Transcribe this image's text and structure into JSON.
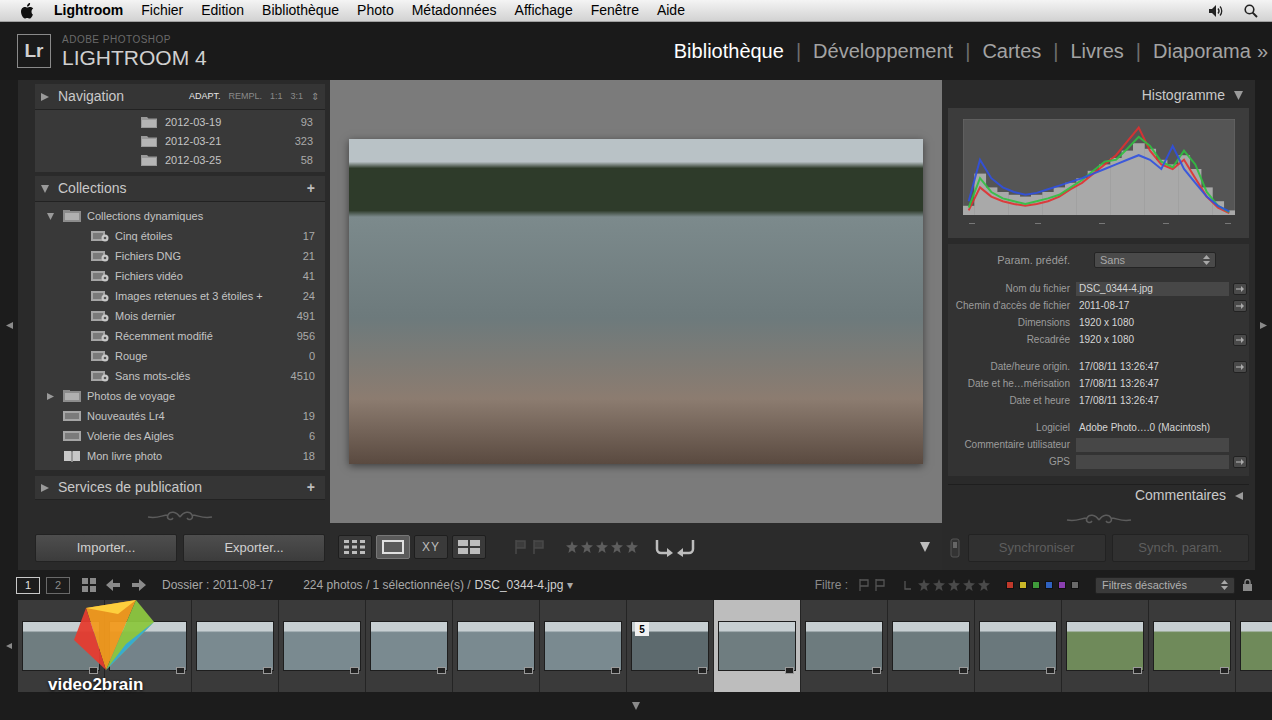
{
  "menubar": {
    "items": [
      {
        "label": "Lightroom",
        "kind": "app"
      },
      {
        "label": "Fichier",
        "kind": "menu"
      },
      {
        "label": "Edition",
        "kind": "menu"
      },
      {
        "label": "Bibliothèque",
        "kind": "menu"
      },
      {
        "label": "Photo",
        "kind": "menu"
      },
      {
        "label": "Métadonnées",
        "kind": "menu"
      },
      {
        "label": "Affichage",
        "kind": "menu"
      },
      {
        "label": "Fenêtre",
        "kind": "menu"
      },
      {
        "label": "Aide",
        "kind": "menu"
      }
    ]
  },
  "app": {
    "logo": "Lr",
    "maker": "ADOBE PHOTOSHOP",
    "name": "LIGHTROOM 4"
  },
  "modules": {
    "items": [
      {
        "label": "Bibliothèque",
        "selected": true
      },
      {
        "label": "Développement",
        "selected": false
      },
      {
        "label": "Cartes",
        "selected": false
      },
      {
        "label": "Livres",
        "selected": false
      },
      {
        "label": "Diaporama",
        "selected": false
      }
    ],
    "separator": "|",
    "more": "»"
  },
  "navigator": {
    "title": "Navigation",
    "expanded": false,
    "zoom": [
      {
        "label": "ADAPT.",
        "selected": true
      },
      {
        "label": "REMPL.",
        "selected": false
      },
      {
        "label": "1:1",
        "selected": false
      },
      {
        "label": "3:1",
        "selected": false
      }
    ],
    "zoom_more": "⇕"
  },
  "folders": [
    {
      "name": "2012-03-19",
      "count": "93"
    },
    {
      "name": "2012-03-21",
      "count": "323"
    },
    {
      "name": "2012-03-25",
      "count": "58"
    }
  ],
  "collections": {
    "title": "Collections",
    "expanded": true,
    "add": "+",
    "items": [
      {
        "name": "Collections dynamiques",
        "count": "",
        "kind": "set",
        "expanded": true,
        "children": [
          {
            "name": "Cinq étoiles",
            "count": "17",
            "kind": "smart"
          },
          {
            "name": "Fichiers DNG",
            "count": "21",
            "kind": "smart"
          },
          {
            "name": "Fichiers vidéo",
            "count": "41",
            "kind": "smart"
          },
          {
            "name": "Images retenues et 3 étoiles +",
            "count": "24",
            "kind": "smart"
          },
          {
            "name": "Mois dernier",
            "count": "491",
            "kind": "smart"
          },
          {
            "name": "Récemment modifié",
            "count": "956",
            "kind": "smart"
          },
          {
            "name": "Rouge",
            "count": "0",
            "kind": "smart"
          },
          {
            "name": "Sans mots-clés",
            "count": "4510",
            "kind": "smart"
          }
        ]
      },
      {
        "name": "Photos de voyage",
        "count": "",
        "kind": "set",
        "expanded": false,
        "children": []
      },
      {
        "name": "Nouveautés Lr4",
        "count": "19",
        "kind": "collection"
      },
      {
        "name": "Volerie des Aigles",
        "count": "6",
        "kind": "collection"
      },
      {
        "name": "Mon livre photo",
        "count": "18",
        "kind": "book"
      }
    ]
  },
  "publish": {
    "title": "Services de publication",
    "expanded": false,
    "add": "+"
  },
  "left_buttons": {
    "import": "Importer...",
    "export": "Exporter..."
  },
  "toolbar": {
    "views": [
      {
        "kind": "grid",
        "selected": false,
        "label": ""
      },
      {
        "kind": "loupe",
        "selected": true,
        "label": ""
      },
      {
        "kind": "compare",
        "selected": false,
        "label": "XY"
      },
      {
        "kind": "survey",
        "selected": false,
        "label": ""
      }
    ],
    "rating": {
      "stars": 0
    }
  },
  "histogram": {
    "title": "Histogramme",
    "expanded": true,
    "series": [
      {
        "kind": "bars",
        "color": "#a9a9a9",
        "values": [
          10,
          45,
          30,
          25,
          22,
          20,
          22,
          25,
          30,
          35,
          40,
          48,
          55,
          62,
          70,
          78,
          72,
          60,
          55,
          65,
          50,
          30,
          15,
          5
        ]
      },
      {
        "kind": "line",
        "color": "#e03030",
        "values": [
          5,
          30,
          20,
          15,
          12,
          10,
          12,
          15,
          20,
          28,
          35,
          45,
          55,
          65,
          80,
          95,
          70,
          55,
          50,
          60,
          40,
          20,
          8,
          2
        ]
      },
      {
        "kind": "line",
        "color": "#30c040",
        "values": [
          8,
          40,
          25,
          18,
          15,
          12,
          15,
          18,
          22,
          30,
          38,
          48,
          58,
          60,
          72,
          85,
          75,
          58,
          52,
          70,
          55,
          25,
          10,
          3
        ]
      },
      {
        "kind": "line",
        "color": "#3050e0",
        "values": [
          15,
          60,
          40,
          30,
          25,
          22,
          24,
          28,
          32,
          36,
          40,
          45,
          50,
          55,
          60,
          65,
          60,
          50,
          75,
          50,
          35,
          20,
          10,
          4
        ]
      }
    ]
  },
  "preset": {
    "label": "Param. prédéf.",
    "value": "Sans"
  },
  "metadata": [
    [
      {
        "label": "Nom du fichier",
        "value": "DSC_0344-4.jpg",
        "editable": true,
        "button": true
      },
      {
        "label": "Chemin d'accès de fichier",
        "value": "2011-08-17",
        "editable": false,
        "button": true
      },
      {
        "label": "Dimensions",
        "value": "1920 x 1080",
        "editable": false,
        "button": false
      },
      {
        "label": "Recadrée",
        "value": "1920 x 1080",
        "editable": false,
        "button": true
      }
    ],
    [
      {
        "label": "Date/heure origin.",
        "value": "17/08/11 13:26:47",
        "editable": false,
        "button": true
      },
      {
        "label": "Date et he…mérisation",
        "value": "17/08/11 13:26:47",
        "editable": false,
        "button": false
      },
      {
        "label": "Date et heure",
        "value": "17/08/11 13:26:47",
        "editable": false,
        "button": false
      }
    ],
    [
      {
        "label": "Logiciel",
        "value": "Adobe Photo….0 (Macintosh)",
        "editable": false,
        "button": false
      },
      {
        "label": "Commentaire utilisateur",
        "value": "",
        "editable": true,
        "button": false
      },
      {
        "label": "GPS",
        "value": "",
        "editable": true,
        "button": true
      }
    ]
  ],
  "comments": {
    "title": "Commentaires",
    "expanded": false
  },
  "sync": {
    "sync": "Synchroniser",
    "sync_settings": "Synch. param.",
    "disabled": true
  },
  "filmstrip": {
    "screens": [
      {
        "label": "1",
        "selected": true
      },
      {
        "label": "2",
        "selected": false
      }
    ],
    "source": "Dossier : 2011-08-17",
    "info": "224 photos / 1 sélectionnée(s) /",
    "file": "DSC_0344-4.jpg",
    "file_menu": "▾",
    "filter_label": "Filtre :",
    "filter_colors": [
      {
        "color": "#c0392b"
      },
      {
        "color": "#c9b628"
      },
      {
        "color": "#3f9a3a"
      },
      {
        "color": "#2f62c0"
      },
      {
        "color": "#8a3fb0"
      },
      {
        "color": "#6a6a6a"
      }
    ],
    "filter_value": "Filtres désactivés"
  },
  "thumbnails": [
    {
      "selected": false,
      "badge": "",
      "color": "#6f7d80"
    },
    {
      "selected": false,
      "badge": "",
      "color": "#74838a"
    },
    {
      "selected": false,
      "badge": "",
      "color": "#7a8a90"
    },
    {
      "selected": false,
      "badge": "",
      "color": "#7a8a90"
    },
    {
      "selected": false,
      "badge": "",
      "color": "#7a8a90"
    },
    {
      "selected": false,
      "badge": "",
      "color": "#7a8a90"
    },
    {
      "selected": false,
      "badge": "",
      "color": "#7a8a90"
    },
    {
      "selected": false,
      "badge": "5",
      "color": "#5d6a6e"
    },
    {
      "selected": true,
      "badge": "",
      "color": "#6f7d80"
    },
    {
      "selected": false,
      "badge": "",
      "color": "#6d7b7e"
    },
    {
      "selected": false,
      "badge": "",
      "color": "#6d7b7e"
    },
    {
      "selected": false,
      "badge": "",
      "color": "#6a787c"
    },
    {
      "selected": false,
      "badge": "",
      "color": "#6f8a5a"
    },
    {
      "selected": false,
      "badge": "",
      "color": "#6f8a5a"
    },
    {
      "selected": false,
      "badge": "",
      "color": "#6f8a5a"
    }
  ],
  "watermark": {
    "text": "video2brain"
  }
}
